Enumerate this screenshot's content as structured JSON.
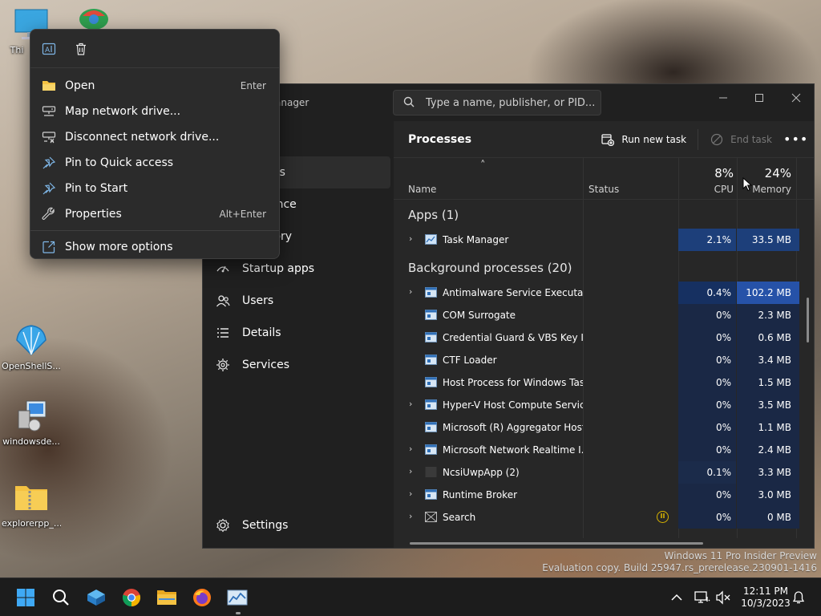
{
  "colors": {
    "accent": "#2652a8",
    "taskbar": "#1c1c1c",
    "menu_bg": "#2b2b2b",
    "folder": "#f5c242",
    "status_icon": "#d8b300"
  },
  "desktop": {
    "icons": [
      {
        "label": "Thi",
        "icon": "this-pc-icon"
      },
      {
        "label": "",
        "icon": "app-globe-icon"
      },
      {
        "label": "OpenShellS...",
        "icon": "openshell-icon"
      },
      {
        "label": "windowsde...",
        "icon": "installer-icon"
      },
      {
        "label": "explorerpp_...",
        "icon": "zip-folder-icon"
      }
    ]
  },
  "context_menu": {
    "top_icons": [
      "rename-icon",
      "delete-icon"
    ],
    "items": [
      {
        "label": "Open",
        "shortcut": "Enter",
        "icon": "folder-open-icon"
      },
      {
        "label": "Map network drive...",
        "shortcut": "",
        "icon": "map-drive-icon"
      },
      {
        "label": "Disconnect network drive...",
        "shortcut": "",
        "icon": "disconnect-drive-icon"
      },
      {
        "label": "Pin to Quick access",
        "shortcut": "",
        "icon": "pin-icon"
      },
      {
        "label": "Pin to Start",
        "shortcut": "",
        "icon": "pin-icon"
      },
      {
        "label": "Properties",
        "shortcut": "Alt+Enter",
        "icon": "wrench-icon"
      },
      {
        "label": "Show more options",
        "shortcut": "",
        "icon": "share-out-icon"
      }
    ]
  },
  "task_manager": {
    "title_partial": "anager",
    "search_placeholder": "Type a name, publisher, or PID...",
    "nav": [
      {
        "label": "es",
        "icon": "processes-icon"
      },
      {
        "label": "ance",
        "icon": "performance-icon"
      },
      {
        "label": "tory",
        "icon": "history-icon"
      },
      {
        "label": "Startup apps",
        "icon": "startup-icon"
      },
      {
        "label": "Users",
        "icon": "users-icon"
      },
      {
        "label": "Details",
        "icon": "details-icon"
      },
      {
        "label": "Services",
        "icon": "services-icon"
      }
    ],
    "settings_label": "Settings",
    "header": {
      "title": "Processes",
      "run_new_task": "Run new task",
      "end_task": "End task",
      "more": "•••"
    },
    "columns": {
      "sort_indicator": "˄",
      "name": "Name",
      "status": "Status",
      "cpu_pct": "8%",
      "cpu": "CPU",
      "memory_pct": "24%",
      "memory": "Memory"
    },
    "apps_group": "Apps (1)",
    "apps": [
      {
        "name": "Task Manager",
        "cpu": "2.1%",
        "memory": "33.5 MB",
        "expandable": true,
        "icon": "task-manager-icon"
      }
    ],
    "bg_group": "Background processes (20)",
    "background": [
      {
        "name": "Antimalware Service Executable",
        "cpu": "0.4%",
        "memory": "102.2 MB",
        "expandable": true,
        "icon": "process-window-icon"
      },
      {
        "name": "COM Surrogate",
        "cpu": "0%",
        "memory": "2.3 MB",
        "expandable": false,
        "icon": "process-window-icon"
      },
      {
        "name": "Credential Guard & VBS Key Is...",
        "cpu": "0%",
        "memory": "0.6 MB",
        "expandable": false,
        "icon": "process-window-icon"
      },
      {
        "name": "CTF Loader",
        "cpu": "0%",
        "memory": "3.4 MB",
        "expandable": false,
        "icon": "process-window-icon"
      },
      {
        "name": "Host Process for Windows Tasks",
        "cpu": "0%",
        "memory": "1.5 MB",
        "expandable": false,
        "icon": "process-window-icon"
      },
      {
        "name": "Hyper-V Host Compute Service",
        "cpu": "0%",
        "memory": "3.5 MB",
        "expandable": true,
        "icon": "process-window-icon"
      },
      {
        "name": "Microsoft (R) Aggregator Host",
        "cpu": "0%",
        "memory": "1.1 MB",
        "expandable": false,
        "icon": "process-window-icon"
      },
      {
        "name": "Microsoft Network Realtime I...",
        "cpu": "0%",
        "memory": "2.4 MB",
        "expandable": true,
        "icon": "process-window-icon"
      },
      {
        "name": "NcsiUwpApp (2)",
        "cpu": "0.1%",
        "memory": "3.3 MB",
        "expandable": true,
        "icon": "blank-app-icon"
      },
      {
        "name": "Runtime Broker",
        "cpu": "0%",
        "memory": "3.0 MB",
        "expandable": true,
        "icon": "process-window-icon"
      },
      {
        "name": "Search",
        "cpu": "0%",
        "memory": "0 MB",
        "expandable": true,
        "icon": "search-app-icon",
        "status": "suspended"
      }
    ],
    "status_glyph": "II"
  },
  "watermark": {
    "line1": "Windows 11 Pro Insider Preview",
    "line2": "Evaluation copy. Build 25947.rs_prerelease.230901-1416"
  },
  "taskbar": {
    "apps": [
      "start-icon",
      "search-icon",
      "package-icon",
      "chrome-icon",
      "file-explorer-icon",
      "firefox-icon",
      "task-manager-icon"
    ],
    "tray": [
      "chevron-up-icon",
      "network-icon",
      "volume-muted-icon",
      "notification-bell-icon"
    ],
    "time": "12:11 PM",
    "date": "10/3/2023"
  }
}
